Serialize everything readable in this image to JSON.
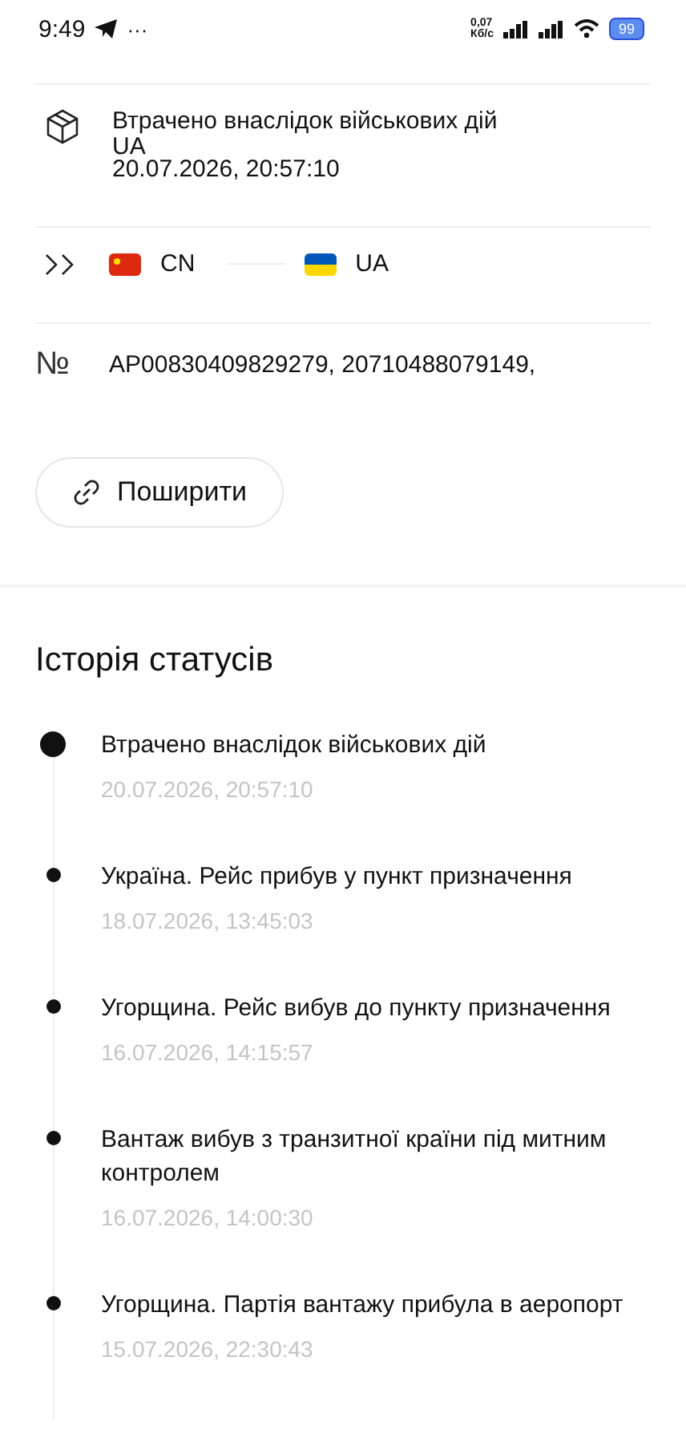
{
  "status_bar": {
    "time": "9:49",
    "more": "···",
    "speed": "0,07",
    "speed_unit": "Кб/с",
    "battery": "99"
  },
  "parcel": {
    "status": "Втрачено внаслідок військових дій",
    "country": "UA",
    "datetime": "20.07.2026, 20:57:10"
  },
  "route": {
    "from": "CN",
    "to": "UA"
  },
  "numbers": {
    "symbol": "№",
    "value": "AP00830409829279, 20710488079149,"
  },
  "share_button": {
    "label": "Поширити"
  },
  "history": {
    "title": "Історія статусів",
    "items": [
      {
        "text": "Втрачено внаслідок військових дій",
        "datetime": "20.07.2026, 20:57:10",
        "current": true
      },
      {
        "text": "Україна. Рейс прибув у пункт призначення",
        "datetime": "18.07.2026, 13:45:03",
        "current": false
      },
      {
        "text": "Угорщина. Рейс вибув до пункту призначення",
        "datetime": "16.07.2026, 14:15:57",
        "current": false
      },
      {
        "text": "Вантаж вибув з транзитної країни під митним контролем",
        "datetime": "16.07.2026, 14:00:30",
        "current": false
      },
      {
        "text": "Угорщина. Партія вантажу прибула в аеропорт",
        "datetime": "15.07.2026, 22:30:43",
        "current": false
      }
    ]
  }
}
